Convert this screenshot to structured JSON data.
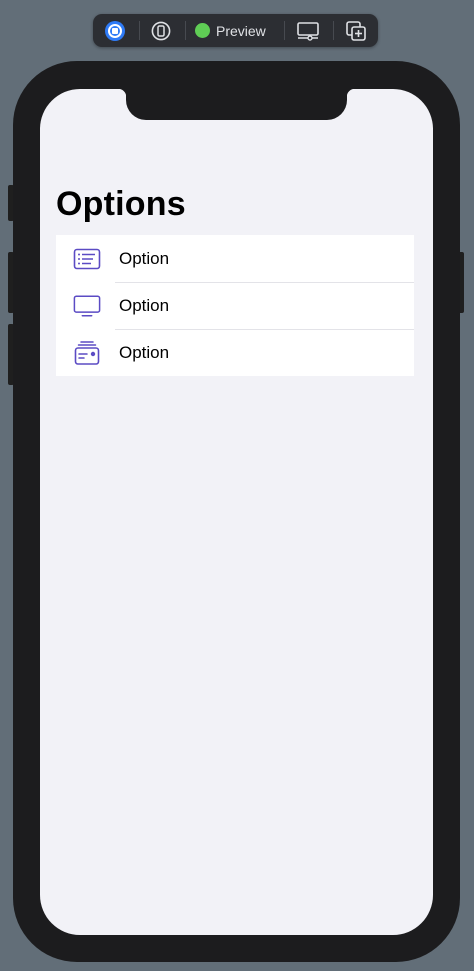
{
  "toolbar": {
    "live_icon": "live-preview-icon",
    "device_icon": "device-icon",
    "preview_label": "Preview",
    "preview_status_color": "#5fcd55",
    "settings_icon": "device-settings-icon",
    "duplicate_icon": "duplicate-preview-icon"
  },
  "screen": {
    "title": "Options",
    "rows": [
      {
        "label": "Option",
        "icon": "list-icon"
      },
      {
        "label": "Option",
        "icon": "display-icon"
      },
      {
        "label": "Option",
        "icon": "wallet-icon"
      }
    ],
    "accent_color": "#5b4bc4",
    "background_color": "#f2f2f7"
  }
}
